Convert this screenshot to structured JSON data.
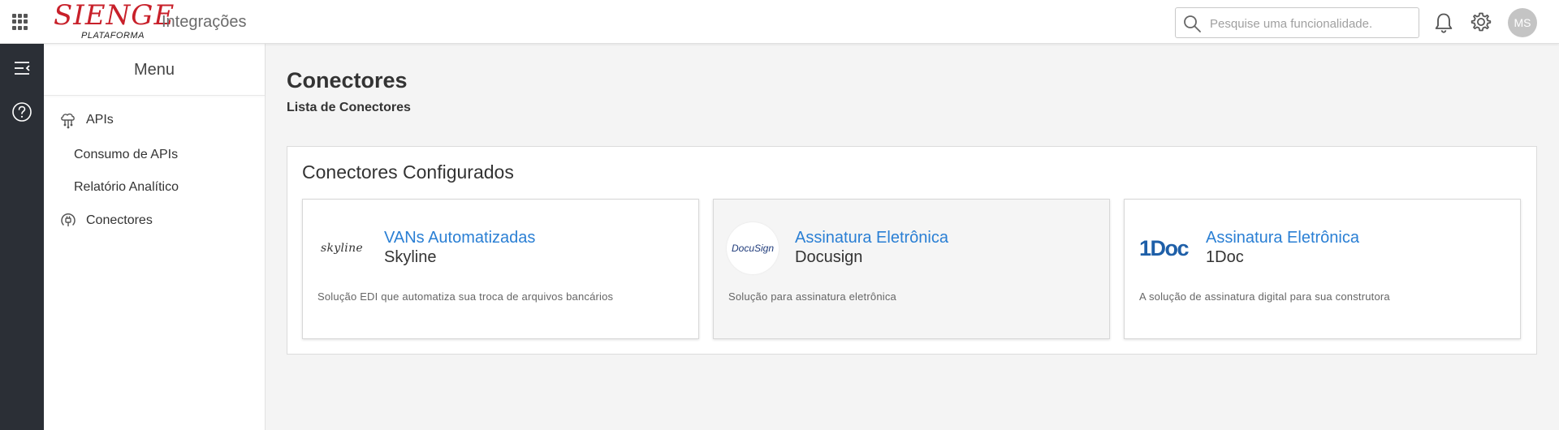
{
  "header": {
    "logo_text": "SIENGE",
    "logo_subtext": "PLATAFORMA",
    "app_title": "Integrações",
    "search_placeholder": "Pesquise uma funcionalidade.",
    "avatar_initials": "MS"
  },
  "sidebar": {
    "title": "Menu",
    "items": [
      {
        "label": "APIs",
        "icon": "cloud-network-icon"
      },
      {
        "label": "Consumo de APIs"
      },
      {
        "label": "Relatório Analítico"
      },
      {
        "label": "Conectores",
        "icon": "plug-icon"
      }
    ]
  },
  "main": {
    "title": "Conectores",
    "subtitle": "Lista de Conectores",
    "panel_title": "Conectores Configurados",
    "cards": [
      {
        "logo": "skyline",
        "name": "VANs Automatizadas",
        "provider": "Skyline",
        "description": "Solução EDI que automatiza sua troca de arquivos bancários"
      },
      {
        "logo": "DocuSign",
        "name": "Assinatura Eletrônica",
        "provider": "Docusign",
        "description": "Solução para assinatura eletrônica"
      },
      {
        "logo": "1Doc",
        "name": "Assinatura Eletrônica",
        "provider": "1Doc",
        "description": "A solução de assinatura digital para sua construtora"
      }
    ]
  },
  "colors": {
    "brand_red": "#c8202a",
    "link_blue": "#2a7fd4",
    "rail_dark": "#2b2f36"
  }
}
